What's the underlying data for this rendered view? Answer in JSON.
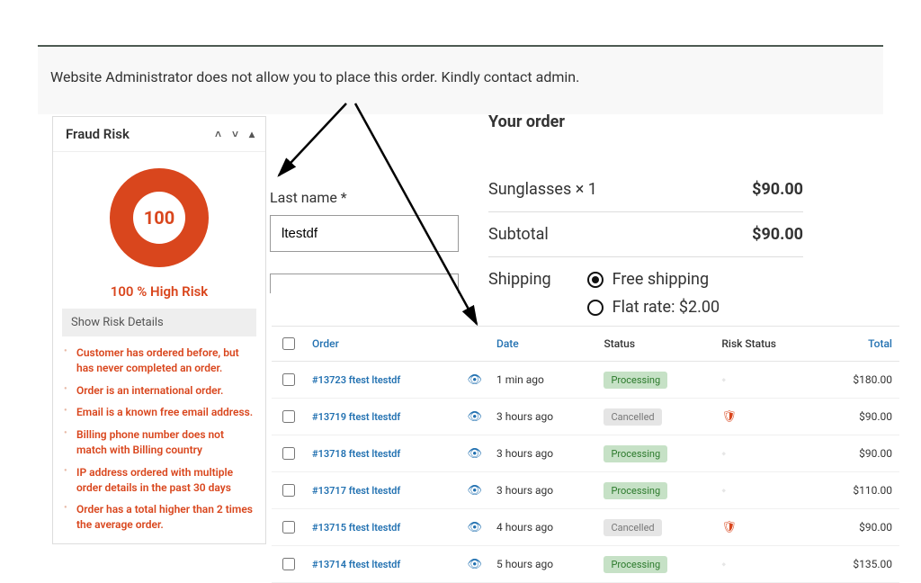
{
  "banner_text": "Website Administrator does not allow you to place this order. Kindly contact admin.",
  "fraud": {
    "title": "Fraud Risk",
    "score": "100",
    "label": "100 % High Risk",
    "show_details": "Show Risk Details",
    "colors": {
      "risk": "#d9461d"
    },
    "reasons": [
      "Customer has ordered before, but has never completed an order.",
      "Order is an international order.",
      "Email is a known free email address.",
      "Billing phone number does not match with Billing country",
      "IP address ordered with multiple order details in the past 30 days",
      "Order has a total higher than 2 times the average order."
    ]
  },
  "checkout": {
    "lastname_label": "Last name *",
    "lastname_value": "ltestdf"
  },
  "order": {
    "heading": "Your order",
    "item_text": "Sunglasses  × 1",
    "item_price": "$90.00",
    "subtotal_label": "Subtotal",
    "subtotal_value": "$90.00",
    "shipping_label": "Shipping",
    "ship_free": "Free shipping",
    "ship_flat": "Flat rate: $2.00"
  },
  "table": {
    "headers": {
      "order": "Order",
      "date": "Date",
      "status": "Status",
      "risk": "Risk Status",
      "total": "Total"
    },
    "rows": [
      {
        "order": "#13723 ftest ltestdf",
        "date": "1 min ago",
        "status": "Processing",
        "status_class": "processing",
        "risk": "none",
        "total": "$180.00"
      },
      {
        "order": "#13719 ftest ltestdf",
        "date": "3 hours ago",
        "status": "Cancelled",
        "status_class": "cancelled",
        "risk": "high",
        "total": "$90.00"
      },
      {
        "order": "#13718 ftest ltestdf",
        "date": "3 hours ago",
        "status": "Processing",
        "status_class": "processing",
        "risk": "none",
        "total": "$90.00"
      },
      {
        "order": "#13717 ftest ltestdf",
        "date": "3 hours ago",
        "status": "Processing",
        "status_class": "processing",
        "risk": "none",
        "total": "$110.00"
      },
      {
        "order": "#13715 ftest ltestdf",
        "date": "4 hours ago",
        "status": "Cancelled",
        "status_class": "cancelled",
        "risk": "high",
        "total": "$90.00"
      },
      {
        "order": "#13714 ftest ltestdf",
        "date": "5 hours ago",
        "status": "Processing",
        "status_class": "processing",
        "risk": "none",
        "total": "$135.00"
      }
    ]
  }
}
